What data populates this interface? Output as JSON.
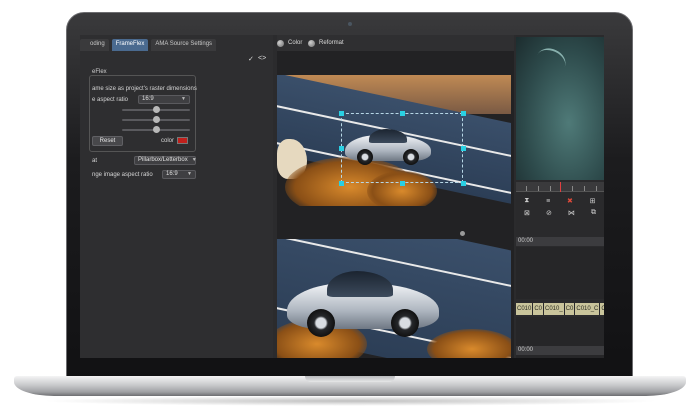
{
  "left_panel": {
    "tabs": [
      "oding",
      "FrameFlex",
      "AMA Source Settings"
    ],
    "active_tab": "FrameFlex",
    "toolbar_check": "✓",
    "toolbar_nav": "<>",
    "group_title": "eFlex",
    "option_text": "ame size as project's raster dimensions",
    "aspect_label": "e aspect ratio",
    "aspect_value": "16:9",
    "reset_label": "Reset",
    "color_label": "color",
    "color_value": "#c0201c",
    "format_label": "at",
    "format_value": "Pillarbox/Letterbox",
    "image_aspect_label": "nge image aspect ratio",
    "image_aspect_value": "16:9",
    "sliders": [
      0.5,
      0.5,
      0.5
    ]
  },
  "viewer": {
    "color_label": "Color",
    "reformat_label": "Reformat"
  },
  "timeline": {
    "timecode_top": "00:00",
    "timecode_bottom": "00:00",
    "tools_row1": [
      "⧗",
      "≡",
      "✖",
      "⊞"
    ],
    "tools_row2": [
      "⊠",
      "⊘",
      "⋈",
      "⧉"
    ],
    "clips": [
      "C010",
      "C0",
      "C010_",
      "C0",
      "C010_C",
      "C0"
    ]
  }
}
